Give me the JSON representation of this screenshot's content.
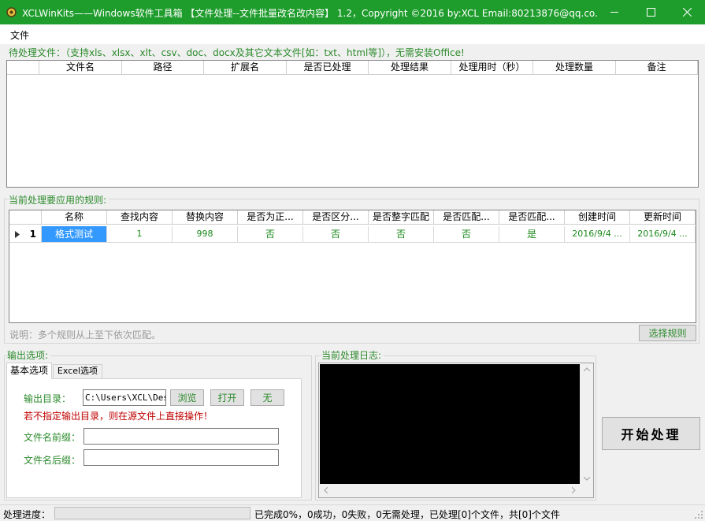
{
  "window": {
    "title": "XCLWinKits——Windows软件工具箱 【文件处理--文件批量改名改内容】 1.2，Copyright ©2016 by:XCL Email:80213876@qq.co...",
    "accent_color": "#1e9c2c"
  },
  "menu": {
    "file": "文件"
  },
  "files_section": {
    "label": "待处理文件：（支持xls、xlsx、xlt、csv、doc、docx及其它文本文件[如：txt、html等]），无需安装Office!",
    "columns": [
      "文件名",
      "路径",
      "扩展名",
      "是否已处理",
      "处理结果",
      "处理用时（秒）",
      "处理数量",
      "备注"
    ]
  },
  "rules_section": {
    "label": "当前处理要应用的规则:",
    "columns": [
      "名称",
      "查找内容",
      "替换内容",
      "是否为正...",
      "是否区分...",
      "是否整字匹配",
      "是否匹配...",
      "是否匹配...",
      "创建时间",
      "更新时间"
    ],
    "rows": [
      {
        "index": "1",
        "cells": [
          "格式测试",
          "1",
          "998",
          "否",
          "否",
          "否",
          "否",
          "是",
          "2016/9/4 ...",
          "2016/9/4 ..."
        ]
      }
    ],
    "hint": "说明：多个规则从上至下依次匹配。",
    "select_button": "选择规则"
  },
  "output_section": {
    "label": "输出选项:",
    "tabs": [
      "基本选项",
      "Excel选项"
    ],
    "output_dir_label": "输出目录：",
    "output_dir_value": "C:\\Users\\XCL\\Des",
    "browse_button": "浏览",
    "open_button": "打开",
    "none_button": "无",
    "warning": "若不指定输出目录，则在源文件上直接操作！",
    "prefix_label": "文件名前缀：",
    "prefix_value": "",
    "suffix_label": "文件名后缀：",
    "suffix_value": ""
  },
  "log_section": {
    "label": "当前处理日志:"
  },
  "start_button": "开始处理",
  "status": {
    "progress_label": "处理进度：",
    "progress": 0,
    "message": "已完成0%，0成功，0失败，0无需处理，已处理[0]个文件，共[0]个文件"
  }
}
